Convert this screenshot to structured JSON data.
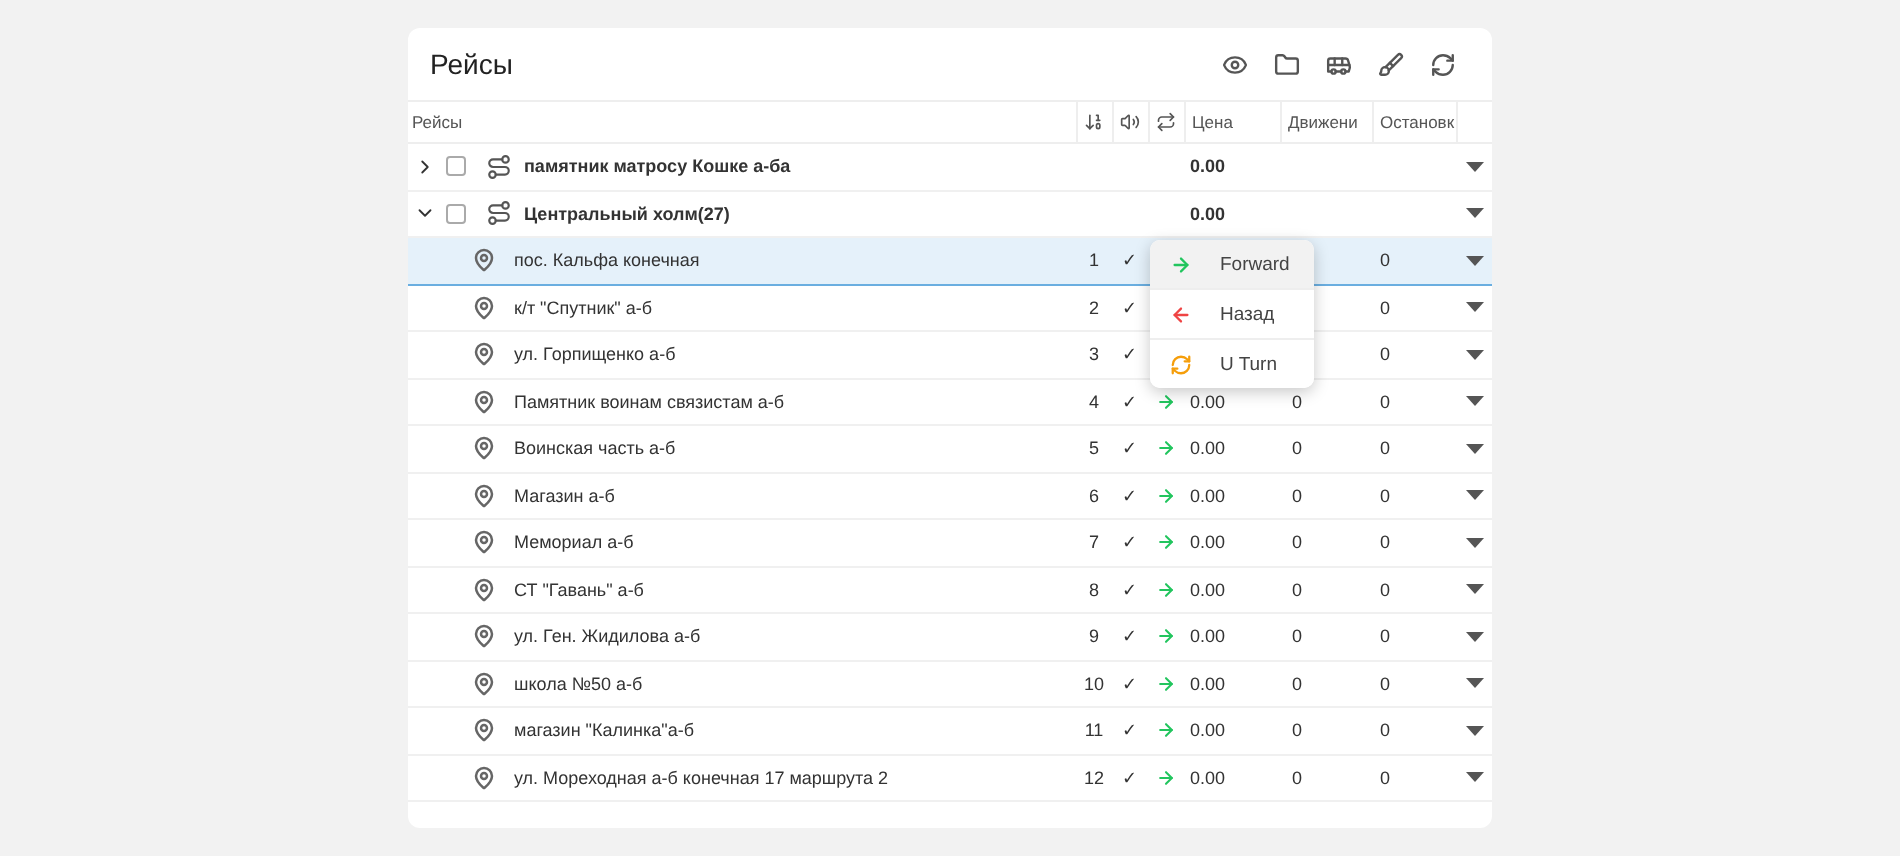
{
  "title": "Рейсы",
  "toolbar": [
    {
      "kind": "eye"
    },
    {
      "kind": "folder"
    },
    {
      "kind": "bus"
    },
    {
      "kind": "broom"
    },
    {
      "kind": "refresh"
    }
  ],
  "columns": [
    {
      "kind": "name",
      "label": "Рейсы"
    },
    {
      "kind": "order"
    },
    {
      "kind": "sound"
    },
    {
      "kind": "repeat"
    },
    {
      "kind": "price",
      "label": "Цена"
    },
    {
      "kind": "movement",
      "label": "Движени"
    },
    {
      "kind": "stops",
      "label": "Остановк"
    },
    {
      "kind": "blank"
    }
  ],
  "routes": [
    {
      "name": "памятник матросу Кошке а-ба",
      "price": "0.00",
      "checked": false,
      "expanded": false
    },
    {
      "name": "Центральный холм(27)",
      "price": "0.00",
      "checked": false,
      "expanded": true,
      "stops": [
        {
          "name": "пос. Кальфа конечная",
          "number": "1",
          "check": "✓",
          "stops": "0",
          "selected": true
        },
        {
          "name": "к/т \"Спутник\" а-б",
          "number": "2",
          "check": "✓",
          "stops": "0",
          "selected": false
        },
        {
          "name": "ул. Горпищенко а-б",
          "number": "3",
          "check": "✓",
          "stops": "0",
          "selected": false
        },
        {
          "name": "Памятник воинам связистам а-б",
          "number": "4",
          "check": "✓",
          "kind": "forward",
          "price": "0.00",
          "movement": "0",
          "stops": "0",
          "selected": false
        },
        {
          "name": "Воинская часть а-б",
          "number": "5",
          "check": "✓",
          "kind": "forward",
          "price": "0.00",
          "movement": "0",
          "stops": "0",
          "selected": false
        },
        {
          "name": "Магазин а-б",
          "number": "6",
          "check": "✓",
          "kind": "forward",
          "price": "0.00",
          "movement": "0",
          "stops": "0",
          "selected": false
        },
        {
          "name": "Мемориал а-б",
          "number": "7",
          "check": "✓",
          "kind": "forward",
          "price": "0.00",
          "movement": "0",
          "stops": "0",
          "selected": false
        },
        {
          "name": "СТ \"Гавань\" а-б",
          "number": "8",
          "check": "✓",
          "kind": "forward",
          "price": "0.00",
          "movement": "0",
          "stops": "0",
          "selected": false
        },
        {
          "name": "ул. Ген. Жидилова а-б",
          "number": "9",
          "check": "✓",
          "kind": "forward",
          "price": "0.00",
          "movement": "0",
          "stops": "0",
          "selected": false
        },
        {
          "name": "школа №50 а-б",
          "number": "10",
          "check": "✓",
          "kind": "forward",
          "price": "0.00",
          "movement": "0",
          "stops": "0",
          "selected": false
        },
        {
          "name": "магазин \"Калинка\"а-б",
          "number": "11",
          "check": "✓",
          "kind": "forward",
          "price": "0.00",
          "movement": "0",
          "stops": "0",
          "selected": false
        },
        {
          "name": "ул. Мореходная а-б конечная 17 маршрута 2",
          "number": "12",
          "check": "✓",
          "kind": "forward",
          "price": "0.00",
          "movement": "0",
          "stops": "0",
          "selected": false
        }
      ]
    }
  ],
  "direction_menu": {
    "items": [
      {
        "label": "Forward",
        "kind": "forward",
        "selected": true
      },
      {
        "label": "Назад",
        "kind": "back",
        "selected": false
      },
      {
        "label": "U Turn",
        "kind": "uturn",
        "selected": false
      }
    ]
  }
}
